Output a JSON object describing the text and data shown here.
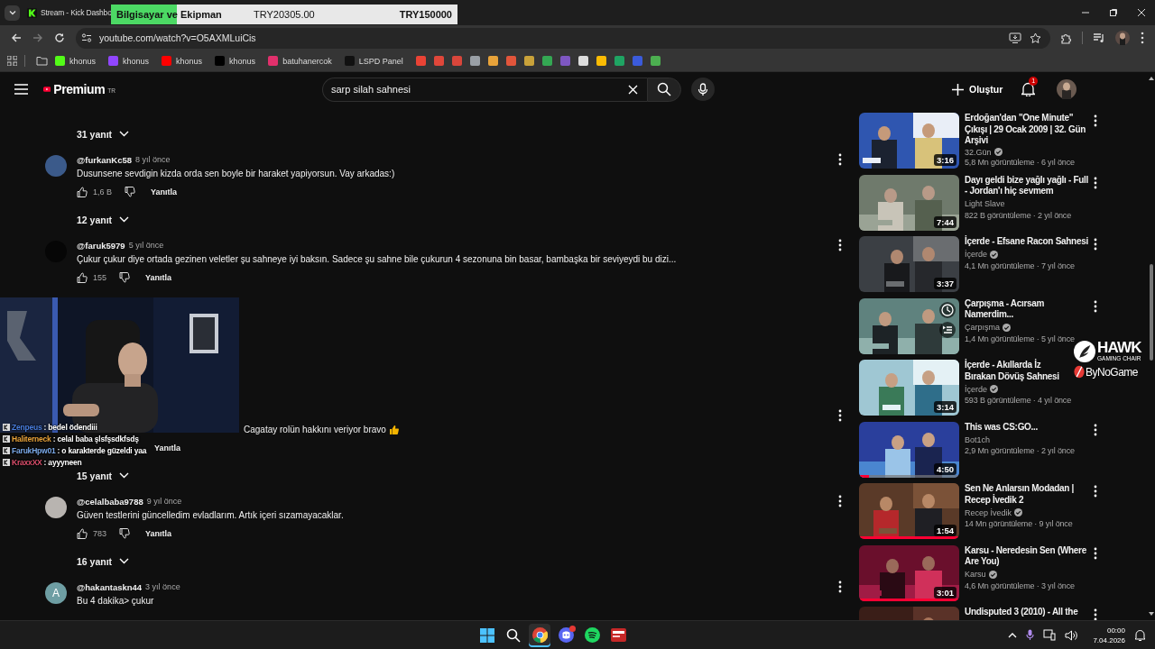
{
  "browser": {
    "tab_title": "Stream - Kick Dashbo",
    "url": "youtube.com/watch?v=O5AXMLuiCis",
    "bookmarks": [
      {
        "label": "khonus",
        "color": "#53fc18"
      },
      {
        "label": "khonus",
        "color": "#9146ff"
      },
      {
        "label": "khonus",
        "color": "#ff0000"
      },
      {
        "label": "khonus",
        "color": "#000000"
      },
      {
        "label": "batuhanercok",
        "color": "#e1306c"
      },
      {
        "label": "LSPD Panel",
        "color": "#111111"
      },
      {
        "color": "#ea4335"
      },
      {
        "color": "#e0473a"
      },
      {
        "color": "#d9463b"
      },
      {
        "color": "#9aa0a6"
      },
      {
        "color": "#e8a33a"
      },
      {
        "color": "#e2553b"
      },
      {
        "color": "#c9a23a"
      },
      {
        "color": "#34a853"
      },
      {
        "color": "#7e57c2"
      },
      {
        "color": "#dddddd"
      },
      {
        "color": "#fbbc04"
      },
      {
        "color": "#1fa463"
      },
      {
        "color": "#3b5bdb"
      },
      {
        "color": "#4caf50"
      }
    ]
  },
  "donation_goal": {
    "title": "Bilgisayar ve Ekipman",
    "raised": "TRY20305.00",
    "goal": "TRY150000",
    "level": 0.19
  },
  "header": {
    "logo": "Premium",
    "region": "TR",
    "search": "sarp silah sahnesi",
    "create": "Oluştur",
    "notifications": "1"
  },
  "comments": [
    {
      "kind": "replies",
      "label": "31 yanıt"
    },
    {
      "kind": "comment",
      "author": "@furkanKc58",
      "time": "8 yıl önce",
      "text": "Dusunsene sevdigin kizda orda sen boyle bir haraket yapiyorsun. Vay arkadas:)",
      "likes": "1,6 B",
      "reply": "Yanıtla",
      "color": "#3b5a8a"
    },
    {
      "kind": "replies",
      "label": "12 yanıt"
    },
    {
      "kind": "comment",
      "author": "@faruk5979",
      "time": "5 yıl önce",
      "text": "Çukur çukur diye ortada gezinen veletler şu sahneye iyi baksın. Sadece şu sahne bile çukurun 4 sezonuna bin basar, bambaşka bir seviyeydi bu dizi...",
      "likes": "155",
      "reply": "Yanıtla",
      "color": "#060606"
    },
    {
      "kind": "partial",
      "text": "Cagatay rolün hakkını veriyor bravo",
      "reply": "Yanıtla"
    },
    {
      "kind": "replies",
      "label": "15 yanıt"
    },
    {
      "kind": "comment",
      "author": "@celalbaba9788",
      "time": "9 yıl önce",
      "text": "Güven testlerini güncelledim evladlarım. Artık içeri sızamayacaklar.",
      "likes": "783",
      "reply": "Yanıtla",
      "color": "#b8b4b0"
    },
    {
      "kind": "replies",
      "label": "16 yanıt"
    },
    {
      "kind": "comment",
      "author": "@hakantaskn44",
      "time": "3 yıl önce",
      "text": "Bu 4 dakika> çukur",
      "letter": "A",
      "color": "#6e9ea3"
    }
  ],
  "videos": [
    {
      "title": "Erdoğan'dan \"One Minute\" Çıkışı | 29 Ocak 2009 | 32. Gün Arşivi",
      "channel": "32.Gün",
      "verified": true,
      "meta": "5,8 Mn görüntüleme · 6 yıl önce",
      "duration": "3:16"
    },
    {
      "title": "Dayı geldi bize yağlı yağlı - Full - Jordan'ı hiç sevmem",
      "channel": "Light Slave",
      "verified": false,
      "meta": "822 B görüntüleme · 2 yıl önce",
      "duration": "7:44"
    },
    {
      "title": "İçerde - Efsane Racon Sahnesi",
      "channel": "İçerde",
      "verified": true,
      "meta": "4,1 Mn görüntüleme · 7 yıl önce",
      "duration": "3:37"
    },
    {
      "title": "Çarpışma - Acırsam Namerdim...",
      "channel": "Çarpışma",
      "verified": true,
      "meta": "1,4 Mn görüntüleme · 5 yıl önce",
      "hover": true
    },
    {
      "title": "İçerde - Akıllarda İz Bırakan Dövüş Sahnesi",
      "channel": "İçerde",
      "verified": true,
      "meta": "593 B görüntüleme · 4 yıl önce",
      "duration": "3:14",
      "menu": false
    },
    {
      "title": "This was CS:GO...",
      "channel": "Bot1ch",
      "verified": false,
      "meta": "2,9 Mn görüntüleme · 2 yıl önce",
      "duration": "4:50",
      "level": 0.1
    },
    {
      "title": "Sen Ne Anlarsın Modadan | Recep İvedik 2",
      "channel": "Recep İvedik",
      "verified": true,
      "meta": "14 Mn görüntüleme · 9 yıl önce",
      "duration": "1:54",
      "level": 1
    },
    {
      "title": "Karsu - Neredesin Sen (Where Are You)",
      "channel": "Karsu",
      "verified": true,
      "meta": "4,6 Mn görüntüleme · 3 yıl önce",
      "duration": "3:01",
      "level": 1
    },
    {
      "title": "Undisputed 3 (2010) - All the"
    }
  ],
  "stream_chat": [
    {
      "user": "Zenpeus",
      "color": "#4a7fe0",
      "message": ": bedel ödendiii"
    },
    {
      "user": "Haliterneck",
      "color": "#e8a33a",
      "message": ": celal baba şlsfşsdkfsdş"
    },
    {
      "user": "FarukHpw01",
      "color": "#7aa8e6",
      "message": ": o karakterde güzeldi yaa"
    },
    {
      "user": "KraxxXX",
      "color": "#e0506e",
      "message": ": ayyyneen"
    }
  ],
  "sponsors": {
    "hawk": "HAWK",
    "hawk_tagline": "GAMING CHAIR",
    "bynogame": "ByNoGame"
  },
  "taskbar": {
    "apps": [
      {
        "kind": "start",
        "active": false
      },
      {
        "kind": "search",
        "active": false
      },
      {
        "kind": "chrome",
        "active": true
      },
      {
        "kind": "discord",
        "active": false,
        "notification": true
      },
      {
        "kind": "spotify",
        "active": false
      },
      {
        "kind": "app",
        "active": false
      }
    ],
    "time": "00:00",
    "date": "7.04.2026"
  }
}
